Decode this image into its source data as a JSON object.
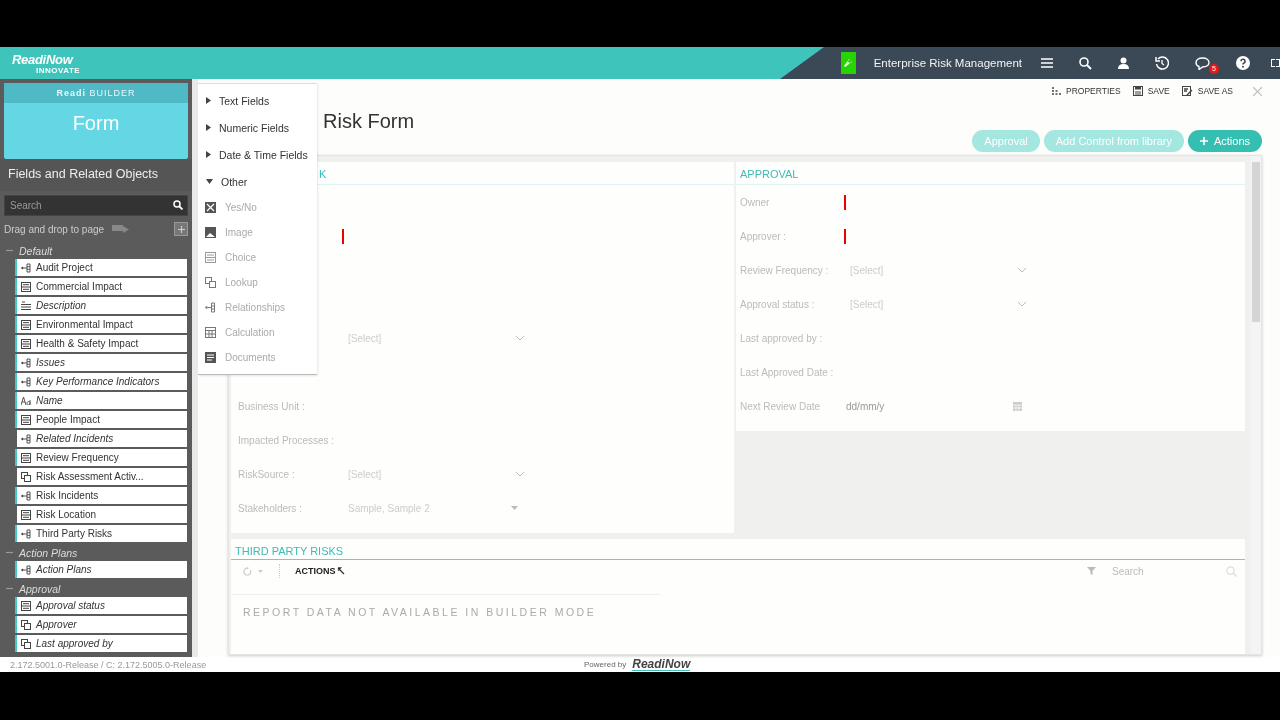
{
  "header": {
    "logo": "ReadiNow",
    "logo_tagline": "INNOVATE",
    "app_name": "Enterprise Risk Management",
    "notification_count": "5"
  },
  "sidebar": {
    "builder_label": "**Readi** BUILDER",
    "builder_type": "Form",
    "panel_title": "Fields and Related Objects",
    "search": {
      "placeholder": "Search"
    },
    "drag_hint": "Drag and drop to page",
    "groups": [
      {
        "name": "Default",
        "expanded": true,
        "items": [
          {
            "label": "Audit Project",
            "kind": "relationship",
            "italic": false,
            "on_form": true
          },
          {
            "label": "Commercial Impact",
            "kind": "choice",
            "italic": false,
            "on_form": true
          },
          {
            "label": "Description",
            "kind": "multiline",
            "italic": true,
            "on_form": true
          },
          {
            "label": "Environmental Impact",
            "kind": "choice",
            "italic": false,
            "on_form": true
          },
          {
            "label": "Health & Safety Impact",
            "kind": "choice",
            "italic": false,
            "on_form": true
          },
          {
            "label": "Issues",
            "kind": "relationship",
            "italic": true,
            "on_form": true
          },
          {
            "label": "Key Performance Indicators",
            "kind": "relationship",
            "italic": true,
            "on_form": true
          },
          {
            "label": "Name",
            "kind": "text",
            "italic": true,
            "on_form": true
          },
          {
            "label": "People Impact",
            "kind": "choice",
            "italic": false,
            "on_form": true
          },
          {
            "label": "Related Incidents",
            "kind": "relationship",
            "italic": true,
            "on_form": false
          },
          {
            "label": "Review Frequency",
            "kind": "choice",
            "italic": false,
            "on_form": true
          },
          {
            "label": "Risk Assessment Activ...",
            "kind": "lookup",
            "italic": false,
            "on_form": false
          },
          {
            "label": "Risk Incidents",
            "kind": "relationship",
            "italic": false,
            "on_form": true
          },
          {
            "label": "Risk Location",
            "kind": "choice",
            "italic": false,
            "on_form": false
          },
          {
            "label": "Third Party Risks",
            "kind": "relationship",
            "italic": false,
            "on_form": true
          }
        ]
      },
      {
        "name": "Action Plans",
        "expanded": true,
        "items": [
          {
            "label": "Action Plans",
            "kind": "relationship",
            "italic": true,
            "on_form": true
          }
        ]
      },
      {
        "name": "Approval",
        "expanded": true,
        "items": [
          {
            "label": "Approval status",
            "kind": "choice",
            "italic": true,
            "on_form": true
          },
          {
            "label": "Approver",
            "kind": "lookup",
            "italic": true,
            "on_form": true
          },
          {
            "label": "Last approved by",
            "kind": "lookup",
            "italic": true,
            "on_form": true
          }
        ]
      }
    ]
  },
  "field_menu": [
    {
      "label": "Text Fields",
      "expanded": false
    },
    {
      "label": "Numeric Fields",
      "expanded": false
    },
    {
      "label": "Date & Time Fields",
      "expanded": false
    },
    {
      "label": "Other",
      "expanded": true,
      "children": [
        {
          "label": "Yes/No",
          "kind": "yesno"
        },
        {
          "label": "Image",
          "kind": "image"
        },
        {
          "label": "Choice",
          "kind": "choice"
        },
        {
          "label": "Lookup",
          "kind": "lookup"
        },
        {
          "label": "Relationships",
          "kind": "relationship"
        },
        {
          "label": "Calculation",
          "kind": "calculation"
        },
        {
          "label": "Documents",
          "kind": "documents"
        }
      ]
    }
  ],
  "toolbar": [
    {
      "label": "PROPERTIES",
      "kind": "properties"
    },
    {
      "label": "SAVE",
      "kind": "save"
    },
    {
      "label": "SAVE AS",
      "kind": "saveas"
    }
  ],
  "form_title": "Risk Form",
  "buttons": [
    {
      "label": "Approval",
      "disabled": true,
      "kind": "plain"
    },
    {
      "label": "Add Control from library",
      "disabled": true,
      "kind": "plain"
    },
    {
      "label": "Actions",
      "disabled": false,
      "kind": "add"
    }
  ],
  "left_section": {
    "title": "K",
    "rows": [
      {
        "kind": "blank"
      },
      {
        "kind": "required"
      },
      {
        "kind": "blank"
      },
      {
        "kind": "blank"
      },
      {
        "kind": "select",
        "value": "[Select]"
      },
      {
        "kind": "blank"
      },
      {
        "kind": "blank",
        "label": "Business Unit :"
      },
      {
        "kind": "blank",
        "label": "Impacted Processes :"
      },
      {
        "kind": "select",
        "label": "RiskSource :",
        "value": "[Select]"
      },
      {
        "kind": "multiselect",
        "label": "Stakeholders :",
        "value": "Sample, Sample 2"
      }
    ]
  },
  "right_section": {
    "title": "APPROVAL",
    "rows": [
      {
        "kind": "required",
        "label": "Owner"
      },
      {
        "kind": "required",
        "label": "Approver :"
      },
      {
        "kind": "select",
        "label": "Review Frequency :",
        "value": "[Select]"
      },
      {
        "kind": "select",
        "label": "Approval status :",
        "value": "[Select]"
      },
      {
        "kind": "blank",
        "label": "Last approved by :"
      },
      {
        "kind": "blank",
        "label": "Last Approved Date :"
      },
      {
        "kind": "date",
        "label": "Next Review Date",
        "placeholder": "dd/mm/y"
      }
    ]
  },
  "report": {
    "title": "THIRD PARTY RISKS",
    "actions": "ACTIONS",
    "search": {
      "placeholder": "Search"
    },
    "message": "REPORT DATA NOT AVAILABLE IN BUILDER MODE"
  },
  "footer": {
    "version": "2.172.5001.0-Release / C: 2.172.5005.0-Release",
    "powered_by": "Powered by",
    "brand": "ReadiNow"
  }
}
